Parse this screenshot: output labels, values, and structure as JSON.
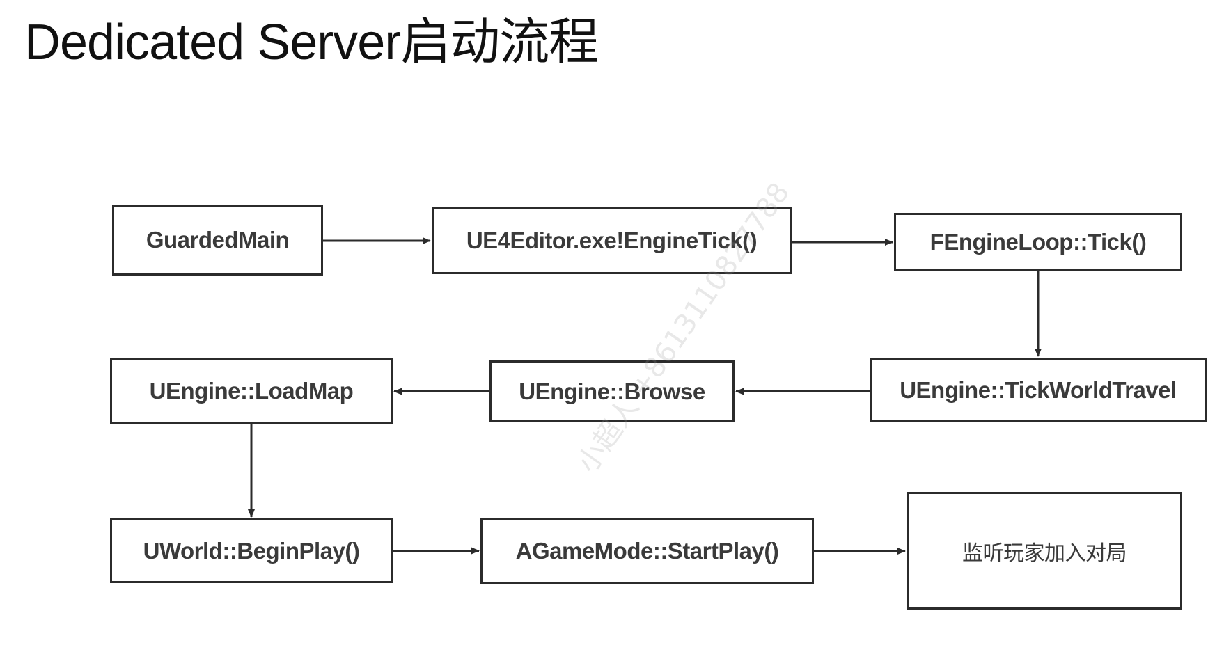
{
  "title": "Dedicated Server启动流程",
  "watermark": "小超人 +8613110827788",
  "nodes": {
    "guarded_main": "GuardedMain",
    "engine_tick": "UE4Editor.exe!EngineTick()",
    "engine_loop_tick": "FEngineLoop::Tick()",
    "tick_world_travel": "UEngine::TickWorldTravel",
    "browse": "UEngine::Browse",
    "load_map": "UEngine::LoadMap",
    "begin_play": "UWorld::BeginPlay()",
    "start_play": "AGameMode::StartPlay()",
    "listen_players": "监听玩家加入对局"
  },
  "edges": [
    {
      "from": "guarded_main",
      "to": "engine_tick"
    },
    {
      "from": "engine_tick",
      "to": "engine_loop_tick"
    },
    {
      "from": "engine_loop_tick",
      "to": "tick_world_travel"
    },
    {
      "from": "tick_world_travel",
      "to": "browse"
    },
    {
      "from": "browse",
      "to": "load_map"
    },
    {
      "from": "load_map",
      "to": "begin_play"
    },
    {
      "from": "begin_play",
      "to": "start_play"
    },
    {
      "from": "start_play",
      "to": "listen_players"
    }
  ],
  "colors": {
    "box_border": "#2b2b2b",
    "box_text": "#3a3a3a",
    "arrow": "#2b2b2b"
  }
}
